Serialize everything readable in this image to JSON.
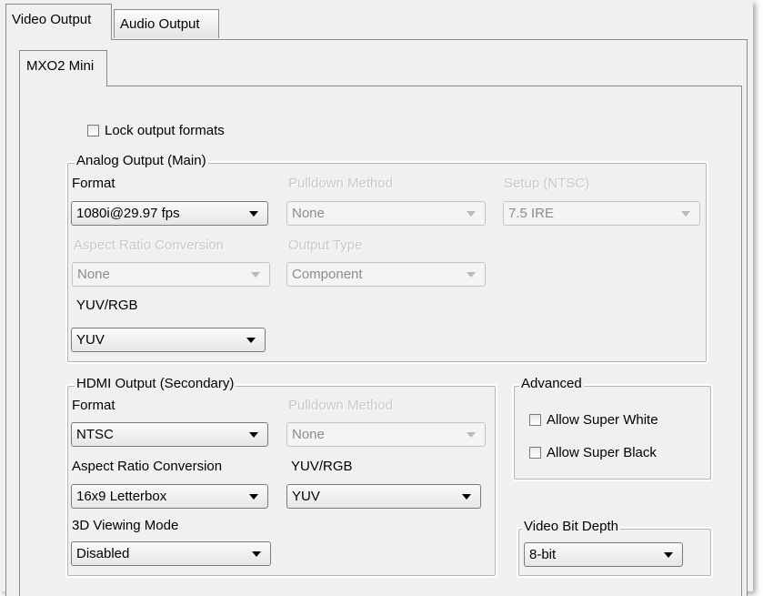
{
  "tabs": {
    "video_output": "Video Output",
    "audio_output": "Audio Output"
  },
  "device_tab": "MXO2 Mini",
  "lock_output_formats": {
    "label": "Lock output formats",
    "checked": false
  },
  "analog": {
    "title": "Analog Output (Main)",
    "format_label": "Format",
    "format_value": "1080i@29.97 fps",
    "pulldown_label": "Pulldown Method",
    "pulldown_value": "None",
    "setup_label": "Setup (NTSC)",
    "setup_value": "7.5 IRE",
    "aspect_label": "Aspect Ratio Conversion",
    "aspect_value": "None",
    "output_type_label": "Output Type",
    "output_type_value": "Component",
    "yuvrgb_label": "YUV/RGB",
    "yuvrgb_value": "YUV"
  },
  "hdmi": {
    "title": "HDMI Output (Secondary)",
    "format_label": "Format",
    "format_value": "NTSC",
    "pulldown_label": "Pulldown Method",
    "pulldown_value": "None",
    "aspect_label": "Aspect Ratio Conversion",
    "aspect_value": "16x9 Letterbox",
    "yuvrgb_label": "YUV/RGB",
    "yuvrgb_value": "YUV",
    "viewing_label": "3D Viewing Mode",
    "viewing_value": "Disabled"
  },
  "advanced": {
    "title": "Advanced",
    "super_white": {
      "label": "Allow Super White",
      "checked": false
    },
    "super_black": {
      "label": "Allow Super Black",
      "checked": false
    }
  },
  "bit_depth": {
    "title": "Video Bit Depth",
    "value": "8-bit"
  },
  "colors": {
    "panel_bg": "#f0f0f0",
    "disabled_text": "#c8c8c8",
    "border": "#8a8a8a"
  }
}
